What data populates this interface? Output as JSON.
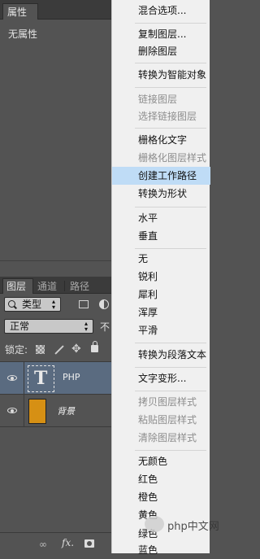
{
  "properties": {
    "tab": "属性",
    "content": "无属性"
  },
  "layers_panel": {
    "tabs": [
      "图层",
      "通道",
      "路径"
    ],
    "filter_label": "类型",
    "blend_mode": "正常",
    "opacity_label_partial": "不",
    "lock_label": "锁定:",
    "layers": [
      {
        "name": "PHP",
        "type": "text",
        "thumb": "T",
        "selected": true
      },
      {
        "name": "背景",
        "type": "image",
        "color": "#d69014",
        "selected": false
      }
    ],
    "footer_icons": [
      "link-icon",
      "fx-icon",
      "mask-icon"
    ],
    "fx_label": "fx."
  },
  "context_menu": {
    "items": [
      {
        "label": "混合选项...",
        "enabled": true
      },
      {
        "label": "复制图层...",
        "enabled": true
      },
      {
        "label": "删除图层",
        "enabled": true
      },
      {
        "label": "转换为智能对象",
        "enabled": true
      },
      {
        "label": "链接图层",
        "enabled": false
      },
      {
        "label": "选择链接图层",
        "enabled": false
      },
      {
        "label": "栅格化文字",
        "enabled": true
      },
      {
        "label": "栅格化图层样式",
        "enabled": false
      },
      {
        "label": "创建工作路径",
        "enabled": true,
        "highlighted": true
      },
      {
        "label": "转换为形状",
        "enabled": true
      },
      {
        "label": "水平",
        "enabled": true
      },
      {
        "label": "垂直",
        "enabled": true
      },
      {
        "label": "无",
        "enabled": true
      },
      {
        "label": "锐利",
        "enabled": true
      },
      {
        "label": "犀利",
        "enabled": true
      },
      {
        "label": "浑厚",
        "enabled": true
      },
      {
        "label": "平滑",
        "enabled": true
      },
      {
        "label": "转换为段落文本",
        "enabled": true
      },
      {
        "label": "文字变形...",
        "enabled": true
      },
      {
        "label": "拷贝图层样式",
        "enabled": false
      },
      {
        "label": "粘贴图层样式",
        "enabled": false
      },
      {
        "label": "清除图层样式",
        "enabled": false
      },
      {
        "label": "无颜色",
        "enabled": true
      },
      {
        "label": "红色",
        "enabled": true
      },
      {
        "label": "橙色",
        "enabled": true
      },
      {
        "label": "黄色",
        "enabled": true
      },
      {
        "label": "绿色",
        "enabled": true
      },
      {
        "label": "蓝色",
        "enabled": true
      }
    ]
  },
  "watermark": "php中文网",
  "colors": {
    "panel_bg": "#535353",
    "menu_bg": "#f0f0f0",
    "highlight": "#bfdcf6",
    "selected_layer": "#5a6b80",
    "bg_layer_thumb": "#d69014"
  }
}
